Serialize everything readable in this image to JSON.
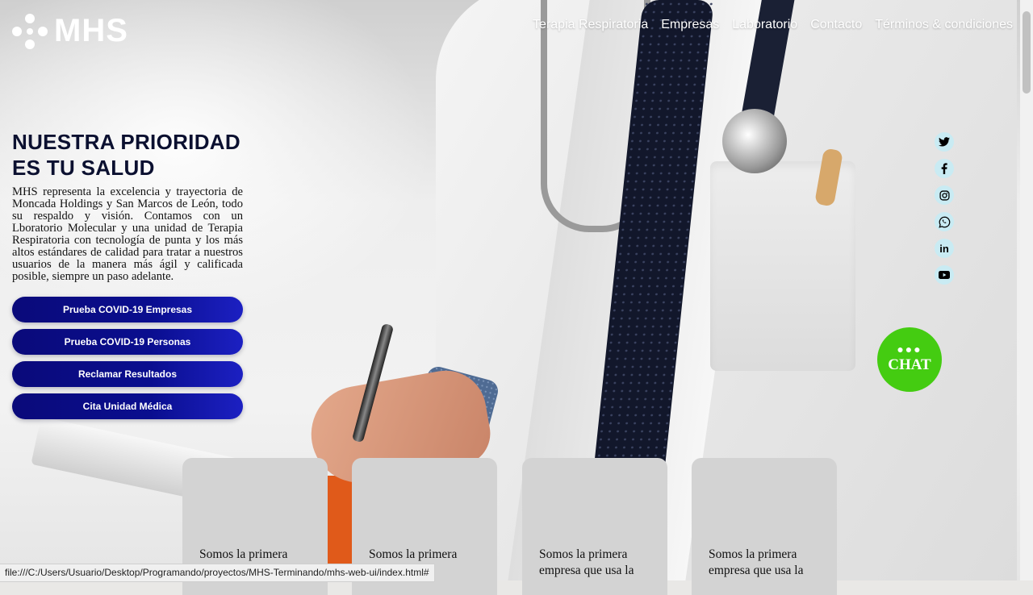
{
  "logo": {
    "text": "MHS"
  },
  "nav": [
    "Terapia Respiratoria",
    "Empresas",
    "Laboratorio",
    "Contacto",
    "Términos & condiciones"
  ],
  "hero": {
    "title": "NUESTRA PRIORIDAD ES TU SALUD",
    "description": "MHS representa la excelencia y trayectoria de Moncada Holdings y San Marcos de León, todo su respaldo y visión. Contamos con un Lboratorio Molecular y una unidad de Terapia Respiratoria con tecnología de punta y los más altos estándares de calidad para tratar a nuestros usuarios de la manera más ágil y calificada posible, siempre un paso adelante."
  },
  "buttons": [
    "Prueba COVID-19 Empresas",
    "Prueba COVID-19 Personas",
    "Reclamar Resultados",
    "Cita Unidad Médica"
  ],
  "socials": [
    "twitter-icon",
    "facebook-icon",
    "instagram-icon",
    "whatsapp-icon",
    "linkedin-icon",
    "youtube-icon"
  ],
  "chat": {
    "label": "CHAT"
  },
  "cards": [
    {
      "text": "Somos la primera"
    },
    {
      "text": "Somos la primera"
    },
    {
      "text": "Somos la primera empresa que usa la"
    },
    {
      "text": "Somos la primera empresa que usa la"
    }
  ],
  "status_bar": {
    "url": "file:///C:/Users/Usuario/Desktop/Programando/proyectos/MHS-Terminando/mhs-web-ui/index.html#"
  },
  "colors": {
    "button": "#0a0e8f",
    "chat": "#44cc11",
    "social": "#c9ebf3",
    "headline": "#0b1030"
  }
}
